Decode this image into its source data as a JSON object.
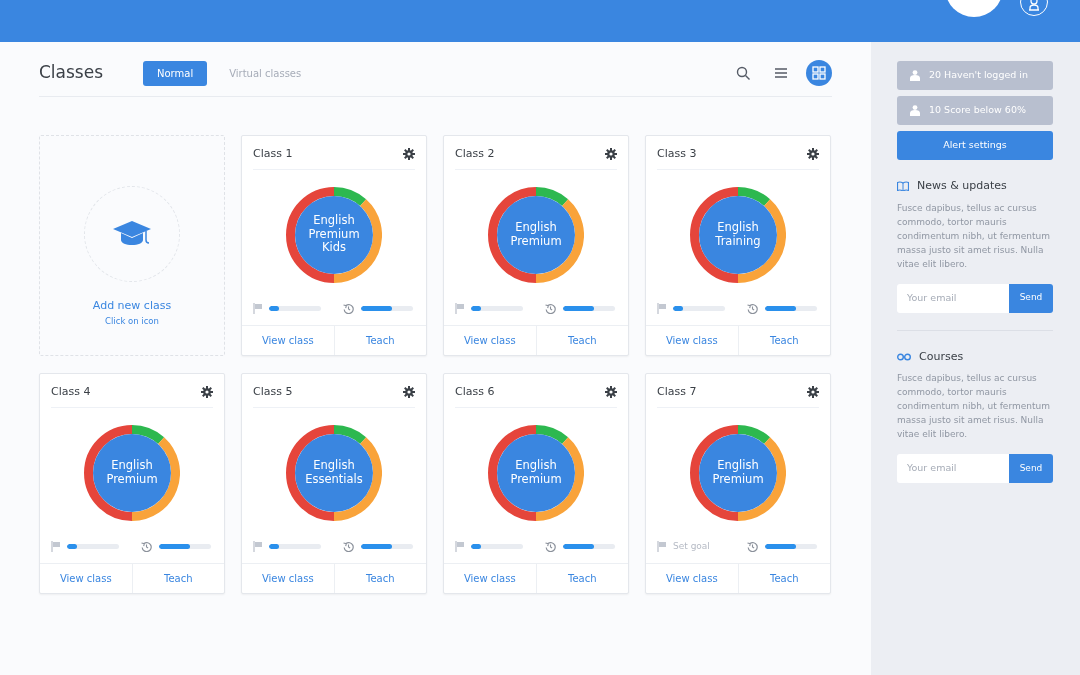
{
  "page": {
    "title": "Classes",
    "tabs": [
      {
        "label": "Normal",
        "selected": true
      },
      {
        "label": "Virtual classes",
        "selected": false
      }
    ],
    "view_icons": [
      {
        "kind": "search",
        "selected": false
      },
      {
        "kind": "list",
        "selected": false
      },
      {
        "kind": "grid",
        "selected": true
      }
    ]
  },
  "add_card": {
    "title": "Add new class",
    "subtitle": "Click on icon"
  },
  "classes": [
    {
      "title": "Class 1",
      "course": "English Premium Kids",
      "goal": {
        "kind": "bar",
        "level": 0.2
      },
      "progress": {
        "level": 0.6
      },
      "actions": [
        "View class",
        "Teach"
      ]
    },
    {
      "title": "Class 2",
      "course": "English Premium",
      "goal": {
        "kind": "bar",
        "level": 0.2
      },
      "progress": {
        "level": 0.6
      },
      "actions": [
        "View class",
        "Teach"
      ]
    },
    {
      "title": "Class 3",
      "course": "English Training",
      "goal": {
        "kind": "bar",
        "level": 0.2
      },
      "progress": {
        "level": 0.6
      },
      "actions": [
        "View class",
        "Teach"
      ]
    },
    {
      "title": "Class 4",
      "course": "English Premium",
      "goal": {
        "kind": "bar",
        "level": 0.2
      },
      "progress": {
        "level": 0.6
      },
      "actions": [
        "View class",
        "Teach"
      ]
    },
    {
      "title": "Class 5",
      "course": "English Essentials",
      "goal": {
        "kind": "bar",
        "level": 0.2
      },
      "progress": {
        "level": 0.6
      },
      "actions": [
        "View class",
        "Teach"
      ]
    },
    {
      "title": "Class 6",
      "course": "English Premium",
      "goal": {
        "kind": "bar",
        "level": 0.2
      },
      "progress": {
        "level": 0.6
      },
      "actions": [
        "View class",
        "Teach"
      ]
    },
    {
      "title": "Class 7",
      "course": "English Premium",
      "goal": {
        "kind": "text",
        "text": "Set goal"
      },
      "progress": {
        "level": 0.6
      },
      "actions": [
        "View class",
        "Teach"
      ]
    }
  ],
  "sidebar": {
    "alerts": [
      {
        "label": "20 Haven't logged in",
        "kind": "alert"
      },
      {
        "label": "10 Score below 60%",
        "kind": "alert"
      },
      {
        "label": "Alert settings",
        "kind": "primary"
      }
    ],
    "sections": [
      {
        "kind": "news",
        "title": "News & updates",
        "text": "Fusce dapibus, tellus ac cursus commodo, tortor mauris condimentum nibh, ut fermentum massa justo sit amet risus. Nulla vitae elit libero.",
        "placeholder": "Your email",
        "button": "Send"
      },
      {
        "kind": "courses",
        "title": "Courses",
        "text": "Fusce dapibus, tellus ac cursus commodo, tortor mauris condimentum nibh, ut fermentum massa justo sit amet risus. Nulla vitae elit libero.",
        "placeholder": "Your email",
        "button": "Send"
      }
    ]
  }
}
